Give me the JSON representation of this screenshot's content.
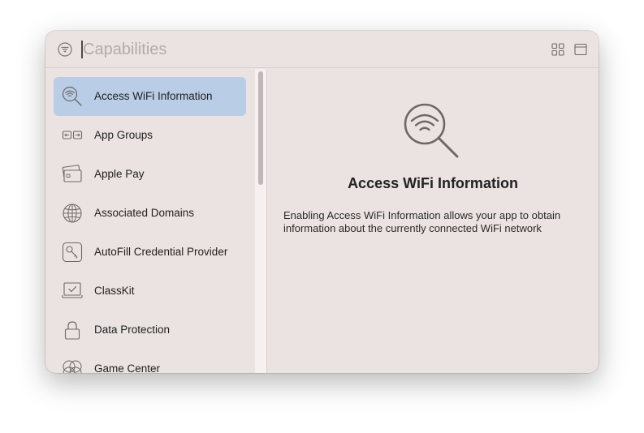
{
  "search": {
    "placeholder": "Capabilities",
    "value": ""
  },
  "sidebar": {
    "items": [
      {
        "label": "Access WiFi Information",
        "icon": "wifi-search-icon",
        "selected": true
      },
      {
        "label": "App Groups",
        "icon": "app-groups-icon",
        "selected": false
      },
      {
        "label": "Apple Pay",
        "icon": "credit-card-icon",
        "selected": false
      },
      {
        "label": "Associated Domains",
        "icon": "globe-icon",
        "selected": false
      },
      {
        "label": "AutoFill Credential Provider",
        "icon": "key-icon",
        "selected": false
      },
      {
        "label": "ClassKit",
        "icon": "classkit-icon",
        "selected": false
      },
      {
        "label": "Data Protection",
        "icon": "lock-icon",
        "selected": false
      },
      {
        "label": "Game Center",
        "icon": "game-center-icon",
        "selected": false
      }
    ]
  },
  "detail": {
    "title": "Access WiFi Information",
    "description": "Enabling Access WiFi Information allows your app to obtain information about the currently connected WiFi network",
    "icon": "wifi-search-icon"
  },
  "colors": {
    "window_background": "#ebe3e1",
    "selection": "#b9cde6",
    "icon_stroke": "#6d6867"
  }
}
